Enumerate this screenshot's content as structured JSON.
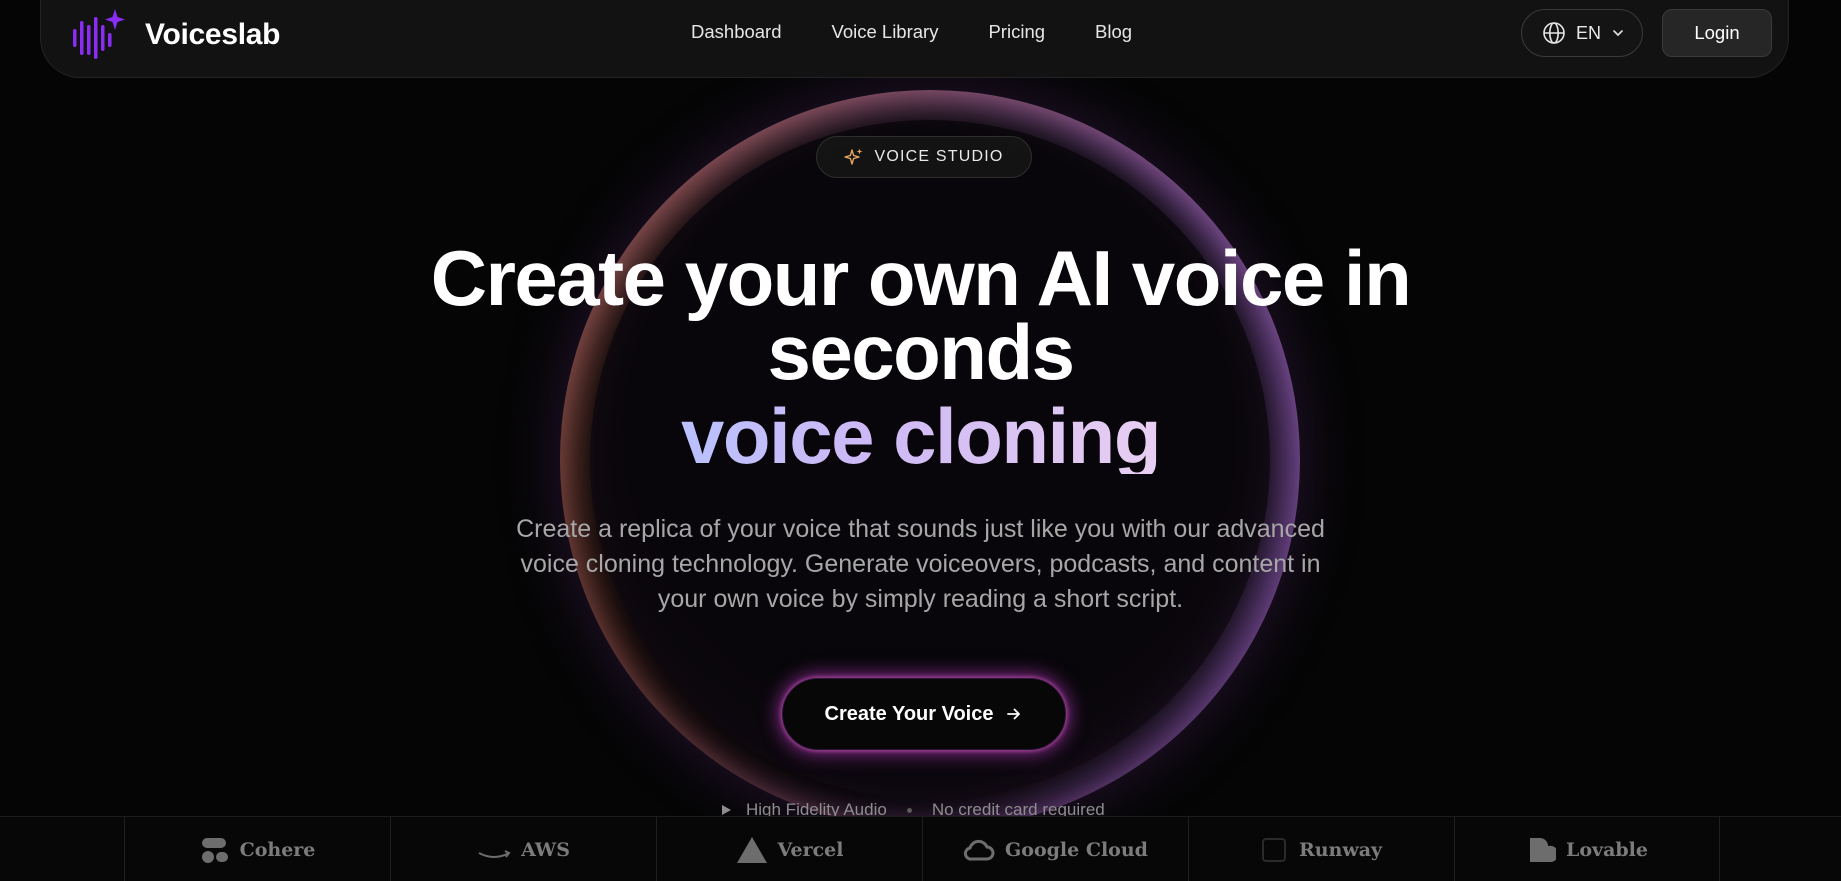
{
  "brand": {
    "name": "Voiceslab",
    "accent": "#8b2cf5"
  },
  "nav": {
    "links": [
      "Dashboard",
      "Voice Library",
      "Pricing",
      "Blog"
    ],
    "language": "EN",
    "login_label": "Login"
  },
  "hero": {
    "badge": "VOICE STUDIO",
    "headline_line1": "Create your own AI voice in",
    "headline_line2": "seconds",
    "headline_highlight": "voice cloning",
    "subcopy": "Create a replica of your voice that sounds just like you with our advanced voice cloning technology. Generate voiceovers, podcasts, and content in your own voice by simply reading a short script.",
    "cta_label": "Create Your Voice",
    "features": [
      "High Fidelity Audio",
      "No credit card required"
    ]
  },
  "partners": [
    {
      "name": "Cohere",
      "icon": "cohere-icon"
    },
    {
      "name": "AWS",
      "icon": "aws-icon"
    },
    {
      "name": "Vercel",
      "icon": "vercel-icon"
    },
    {
      "name": "Google Cloud",
      "icon": "google-cloud-icon"
    },
    {
      "name": "Runway",
      "icon": "runway-icon"
    },
    {
      "name": "Lovable",
      "icon": "lovable-icon"
    }
  ]
}
